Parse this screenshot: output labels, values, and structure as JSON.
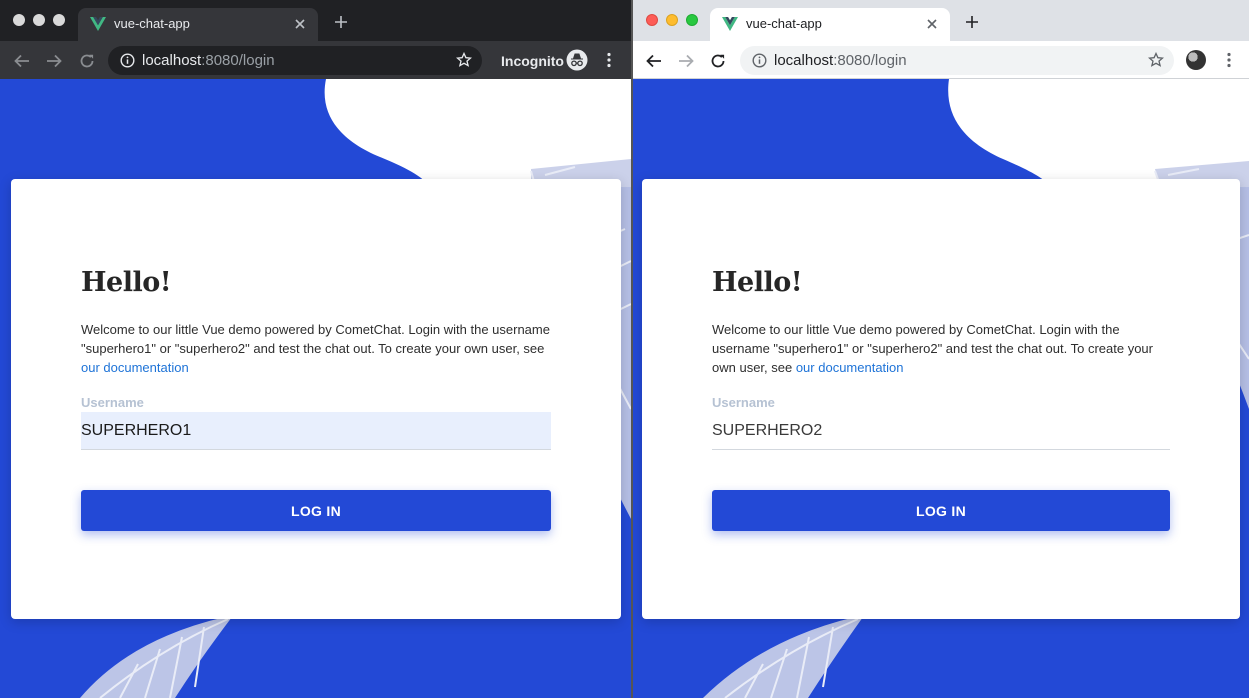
{
  "windows": {
    "left": {
      "mode": "incognito",
      "tab_title": "vue-chat-app",
      "url_host": "localhost",
      "url_path": ":8080/login",
      "incognito_label": "Incognito",
      "card": {
        "heading": "Hello!",
        "intro_text": "Welcome to our little Vue demo powered by CometChat. Login with the username \"superhero1\" or \"superhero2\" and test the chat out. To create your own user, see ",
        "doc_link": "our documentation",
        "username_label": "Username",
        "username_value": "SUPERHERO1",
        "login_label": "LOG IN"
      }
    },
    "right": {
      "mode": "normal",
      "tab_title": "vue-chat-app",
      "url_host": "localhost",
      "url_path": ":8080/login",
      "card": {
        "heading": "Hello!",
        "intro_text": "Welcome to our little Vue demo powered by CometChat. Login with the username \"superhero1\" or \"superhero2\" and test the chat out. To create your own user, see ",
        "doc_link": "our documentation",
        "username_label": "Username",
        "username_value": "SUPERHERO2",
        "login_label": "LOG IN"
      }
    }
  },
  "colors": {
    "brand_blue": "#2349d6",
    "link_blue": "#1e73d7",
    "vue_green": "#41b883",
    "vue_dark": "#35495e"
  },
  "icons": [
    "vue-logo-icon",
    "close-icon",
    "plus-icon",
    "back-arrow-icon",
    "forward-arrow-icon",
    "reload-icon",
    "info-icon",
    "star-icon",
    "incognito-icon",
    "kebab-menu-icon",
    "profile-avatar"
  ]
}
